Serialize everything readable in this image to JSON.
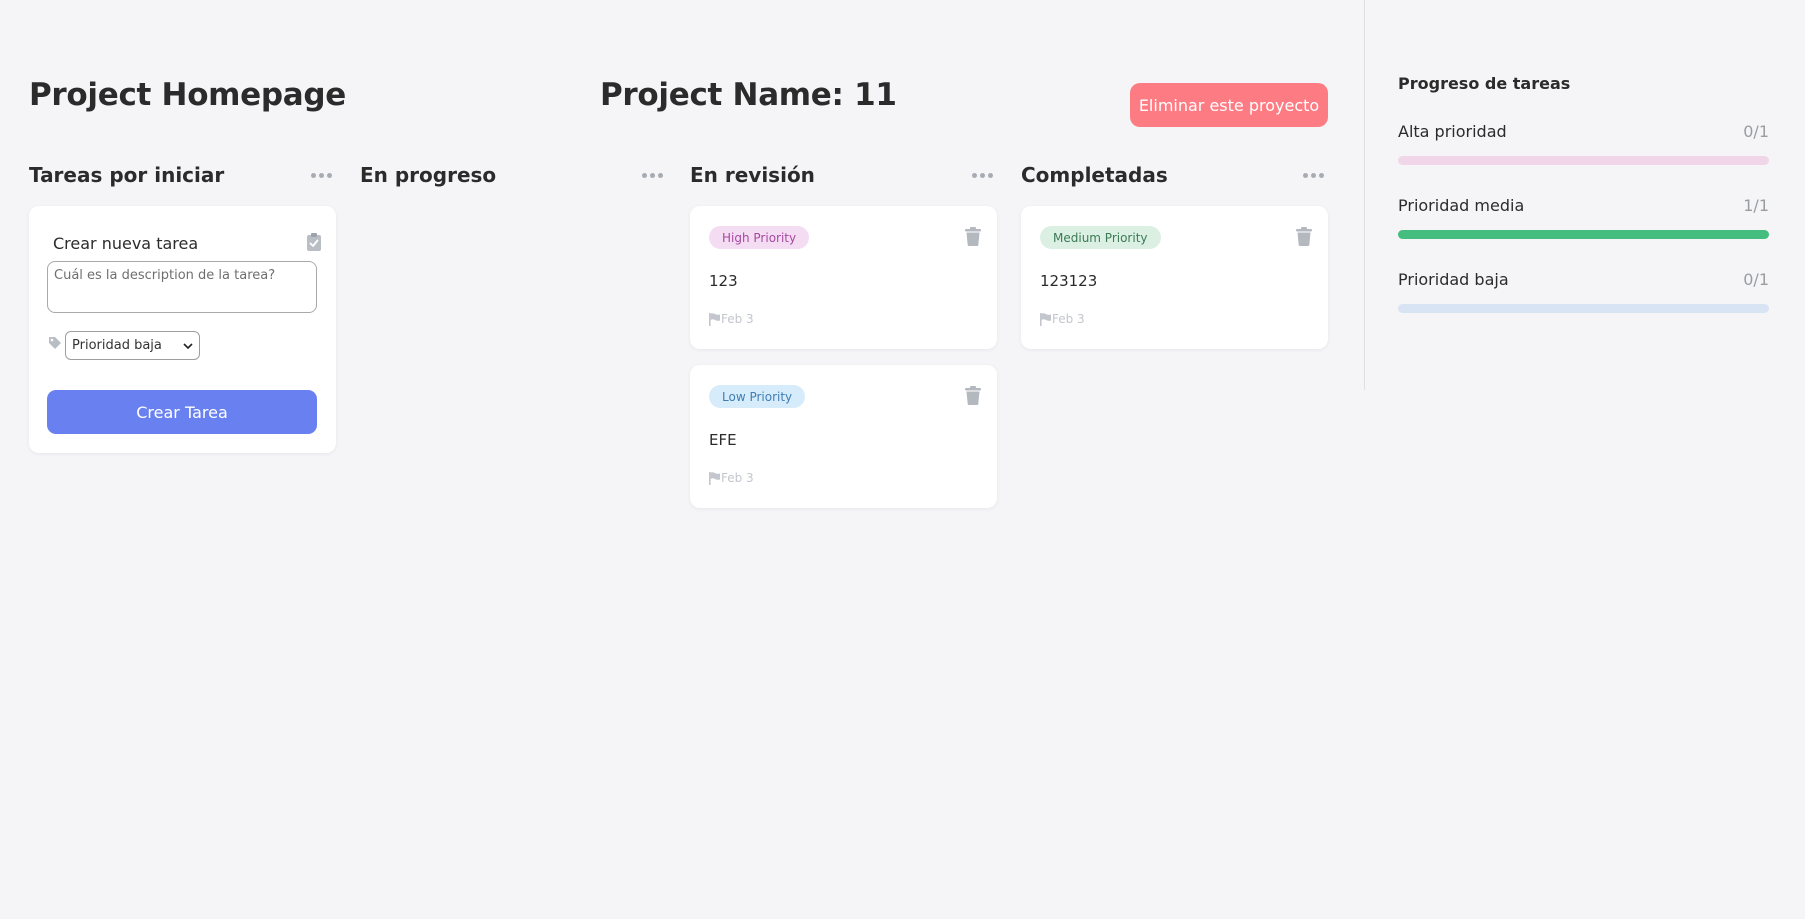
{
  "header": {
    "page_title": "Project Homepage",
    "project_name": "Project Name: 11",
    "delete_label": "Eliminar este proyecto"
  },
  "columns": [
    {
      "title": "Tareas por iniciar"
    },
    {
      "title": "En progreso"
    },
    {
      "title": "En revisión"
    },
    {
      "title": "Completadas"
    }
  ],
  "new_task": {
    "title": "Crear nueva tarea",
    "placeholder": "Cuál es la description de la tarea?",
    "priority_selected": "Prioridad baja",
    "create_label": "Crear Tarea"
  },
  "review_tasks": [
    {
      "badge": "High Priority",
      "text": "123",
      "date": "Feb 3"
    },
    {
      "badge": "Low Priority",
      "text": "EFE",
      "date": "Feb 3"
    }
  ],
  "completed_tasks": [
    {
      "badge": "Medium Priority",
      "text": "123123",
      "date": "Feb 3"
    }
  ],
  "sidebar": {
    "title": "Progreso de tareas",
    "items": [
      {
        "label": "Alta prioridad",
        "count": "0/1",
        "progress": 0
      },
      {
        "label": "Prioridad media",
        "count": "1/1",
        "progress": 1
      },
      {
        "label": "Prioridad baja",
        "count": "0/1",
        "progress": 0
      }
    ]
  },
  "colors": {
    "delete_button": "#fd7c84",
    "create_button": "#6981f0",
    "high_badge_bg": "#f4dcf2",
    "high_badge_text": "#a64aa0",
    "low_badge_bg": "#d6ecfb",
    "low_badge_text": "#3f7db4",
    "medium_badge_bg": "#dbf0e3",
    "medium_badge_text": "#3b7a55",
    "high_track": "#f0d6e8",
    "medium_fill": "#45bd7e",
    "low_track": "#d8e4f3"
  }
}
